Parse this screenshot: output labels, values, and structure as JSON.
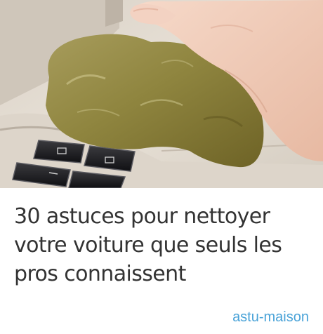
{
  "article": {
    "image_alt": "",
    "title": "30 astuces pour nettoyer votre voiture que seuls les pros connaissent",
    "source": "astu-maison"
  },
  "colors": {
    "title_text": "#333333",
    "source_link": "#4aa3d8",
    "background": "#ffffff"
  },
  "icons": {
    "window-switch-icons": "car door window control buttons"
  }
}
